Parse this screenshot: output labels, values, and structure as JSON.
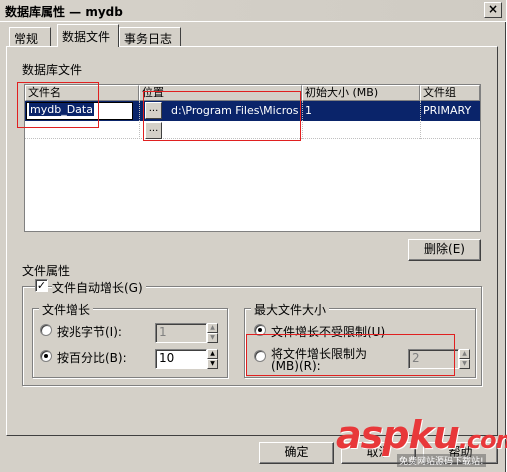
{
  "window": {
    "title": "数据库属性 — mydb",
    "close_glyph": "×"
  },
  "tabs": [
    {
      "label": "常规",
      "active": false
    },
    {
      "label": "数据文件",
      "active": true
    },
    {
      "label": "事务日志",
      "active": false
    }
  ],
  "database_files": {
    "section_label": "数据库文件",
    "columns": [
      "文件名",
      "位置",
      "初始大小 (MB)",
      "文件组"
    ],
    "rows": [
      {
        "file_name": "mydb_Data",
        "location": "d:\\Program Files\\Micros...",
        "initial_size": "1",
        "filegroup": "PRIMARY",
        "selected": true
      }
    ],
    "browse_glyph": "..."
  },
  "buttons": {
    "delete": "删除(E)",
    "ok": "确定",
    "cancel": "取消",
    "help": "帮助"
  },
  "file_properties": {
    "label": "文件属性",
    "auto_grow_label": "文件自动增长(G)",
    "auto_grow_checked": true,
    "check_glyph": "✓",
    "growth": {
      "title": "文件增长",
      "by_mb_label": "按兆字节(I):",
      "by_mb_value": "1",
      "by_percent_label": "按百分比(B):",
      "by_percent_value": "10",
      "selected": "percent"
    },
    "max_size": {
      "title": "最大文件大小",
      "unlimited_label": "文件增长不受限制(U)",
      "limit_label_line1": "将文件增长限制为",
      "limit_label_line2": "(MB)(R):",
      "limit_value": "2",
      "selected": "unlimited"
    },
    "spin_up_glyph": "▲",
    "spin_down_glyph": "▼"
  },
  "watermark": {
    "text": "aspku",
    "suffix": ".com",
    "subtext": "免费网站源码下载站!"
  },
  "colors": {
    "selection": "#0a246a",
    "dialog_bg": "#d4d0c8",
    "annotation_red": "#e02020",
    "watermark_red": "#e8383a"
  }
}
